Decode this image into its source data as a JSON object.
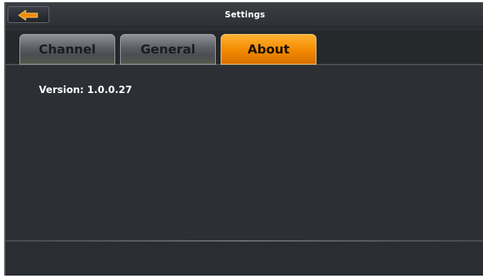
{
  "window": {
    "title": "Settings"
  },
  "header": {
    "back_icon": "back-arrow-icon"
  },
  "tabs": [
    {
      "label": "Channel",
      "active": false
    },
    {
      "label": "General",
      "active": false
    },
    {
      "label": "About",
      "active": true
    }
  ],
  "about": {
    "version_text": "Version: 1.0.0.27"
  },
  "colors": {
    "accent": "#f28a00",
    "background": "#2c2f34",
    "tab_inactive": "#5c6065"
  }
}
